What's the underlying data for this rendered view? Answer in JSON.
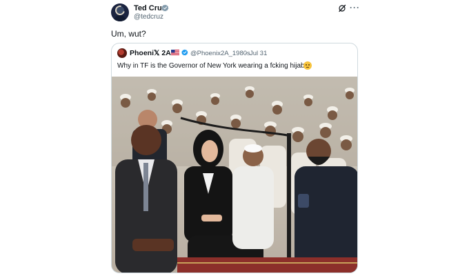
{
  "post": {
    "author_name": "Ted Cruz",
    "author_handle": "@tedcruz",
    "text": "Um, wut?",
    "more_label": "···"
  },
  "quoted_post": {
    "author_name": "Phoeni𝕏 2A",
    "author_handle": "@Phoenix2A_1980s",
    "separator": "·",
    "date": "Jul 31",
    "text": "Why in TF is the Governor of New York wearing a fcking hijab?!"
  },
  "colors": {
    "verified": "#1d9bf0",
    "secondary_text": "#536471",
    "border": "#cfd9de"
  },
  "icons": {
    "verified": "verified-badge-icon",
    "grok": "grok-icon",
    "more": "more-icon",
    "flag": "us-flag-icon",
    "emoji": "smirking-face-icon"
  }
}
